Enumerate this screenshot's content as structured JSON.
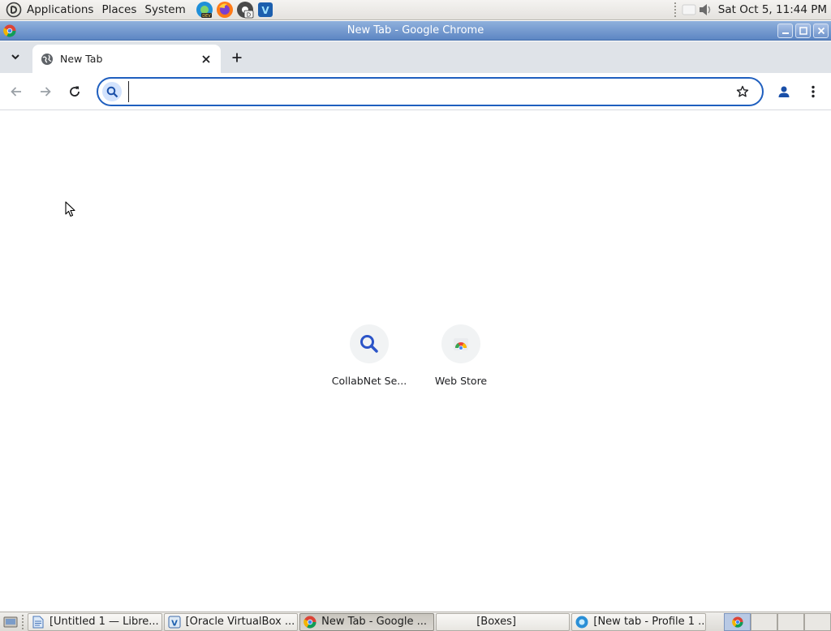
{
  "top_panel": {
    "menus": [
      "Applications",
      "Places",
      "System"
    ],
    "launchers": [
      "edge-dev-icon",
      "firefox-icon",
      "chrome-dev-icon",
      "virtualbox-icon"
    ],
    "clock": "Sat Oct  5, 11:44 PM"
  },
  "window": {
    "title": "New Tab - Google Chrome"
  },
  "browser": {
    "tabs": [
      {
        "title": "New Tab",
        "active": true
      }
    ],
    "omnibox": {
      "value": "",
      "placeholder": ""
    }
  },
  "ntp": {
    "shortcuts": [
      {
        "label": "CollabNet Se...",
        "icon": "search-icon"
      },
      {
        "label": "Web Store",
        "icon": "webstore-icon"
      }
    ]
  },
  "taskbar": {
    "tasks": [
      {
        "label": "[Untitled 1 — Libre...",
        "icon": "document-icon"
      },
      {
        "label": "[Oracle VirtualBox ...",
        "icon": "virtualbox-icon"
      },
      {
        "label": "New Tab - Google ...",
        "icon": "chrome-icon",
        "active": true
      },
      {
        "label": "[Boxes]",
        "icon": "none"
      },
      {
        "label": "[New tab - Profile 1 ...",
        "icon": "edge-icon"
      }
    ],
    "workspaces": 4,
    "active_workspace": 1
  },
  "colors": {
    "titlebar": "#5d86c3",
    "omnibox_focus": "#1f5fbf",
    "tabstrip": "#dfe3e8"
  }
}
